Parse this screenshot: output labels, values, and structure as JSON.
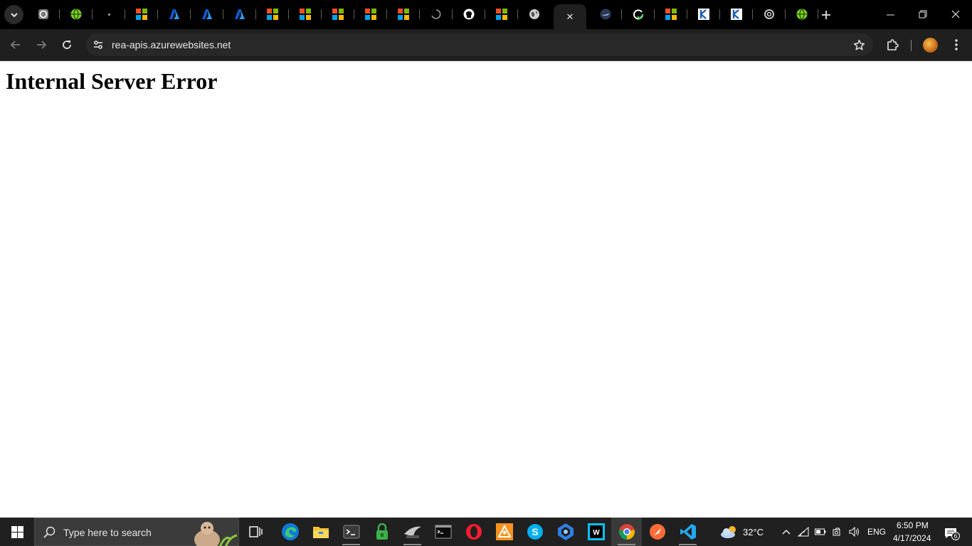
{
  "browser": {
    "tabs": [
      {
        "name": "tab-chatgpt",
        "icon": "chatgpt-icon"
      },
      {
        "name": "tab-green-globe-1",
        "icon": "green-globe-icon"
      },
      {
        "name": "tab-blank-1",
        "icon": "blank-icon"
      },
      {
        "name": "tab-microsoft-1",
        "icon": "microsoft-icon"
      },
      {
        "name": "tab-azure-1",
        "icon": "azure-icon"
      },
      {
        "name": "tab-azure-2",
        "icon": "azure-icon"
      },
      {
        "name": "tab-azure-3",
        "icon": "azure-icon"
      },
      {
        "name": "tab-microsoft-2",
        "icon": "microsoft-icon"
      },
      {
        "name": "tab-microsoft-3",
        "icon": "microsoft-icon"
      },
      {
        "name": "tab-microsoft-4",
        "icon": "microsoft-icon"
      },
      {
        "name": "tab-microsoft-5",
        "icon": "microsoft-icon"
      },
      {
        "name": "tab-microsoft-6",
        "icon": "microsoft-icon"
      },
      {
        "name": "tab-loading",
        "icon": "loading-spinner-icon"
      },
      {
        "name": "tab-github",
        "icon": "github-icon"
      },
      {
        "name": "tab-microsoft-7",
        "icon": "microsoft-icon"
      },
      {
        "name": "tab-globe",
        "icon": "globe-icon"
      },
      {
        "name": "tab-active",
        "icon": "close-icon"
      },
      {
        "name": "tab-docker",
        "icon": "docker-icon"
      },
      {
        "name": "tab-refresh-check",
        "icon": "refresh-check-icon"
      },
      {
        "name": "tab-microsoft-8",
        "icon": "microsoft-icon"
      },
      {
        "name": "tab-k-1",
        "icon": "k-logo-icon"
      },
      {
        "name": "tab-k-2",
        "icon": "k-logo-icon"
      },
      {
        "name": "tab-openai",
        "icon": "openai-icon"
      },
      {
        "name": "tab-green-globe-2",
        "icon": "green-globe-icon"
      }
    ],
    "url": "rea-apis.azurewebsites.net"
  },
  "page": {
    "heading": "Internal Server Error"
  },
  "taskbar": {
    "search_placeholder": "Type here to search",
    "apps": [
      "task-view",
      "edge",
      "file-explorer",
      "terminal",
      "password-manager",
      "wireshark",
      "command-prompt",
      "opera",
      "sourcetree",
      "skype",
      "azure-data-studio",
      "webstorm",
      "chrome",
      "postman",
      "vscode"
    ],
    "weather": {
      "temp": "32°C",
      "icon": "cloudy-sun-icon"
    },
    "language": "ENG",
    "time": "6:50 PM",
    "date": "4/17/2024",
    "notification_count": "6"
  },
  "colors": {
    "tabstrip_bg": "#000000",
    "toolbar_bg": "#1f1f1f",
    "omnibox_bg": "#282828",
    "taskbar_bg": "#202020",
    "accent": "#0078d4"
  }
}
